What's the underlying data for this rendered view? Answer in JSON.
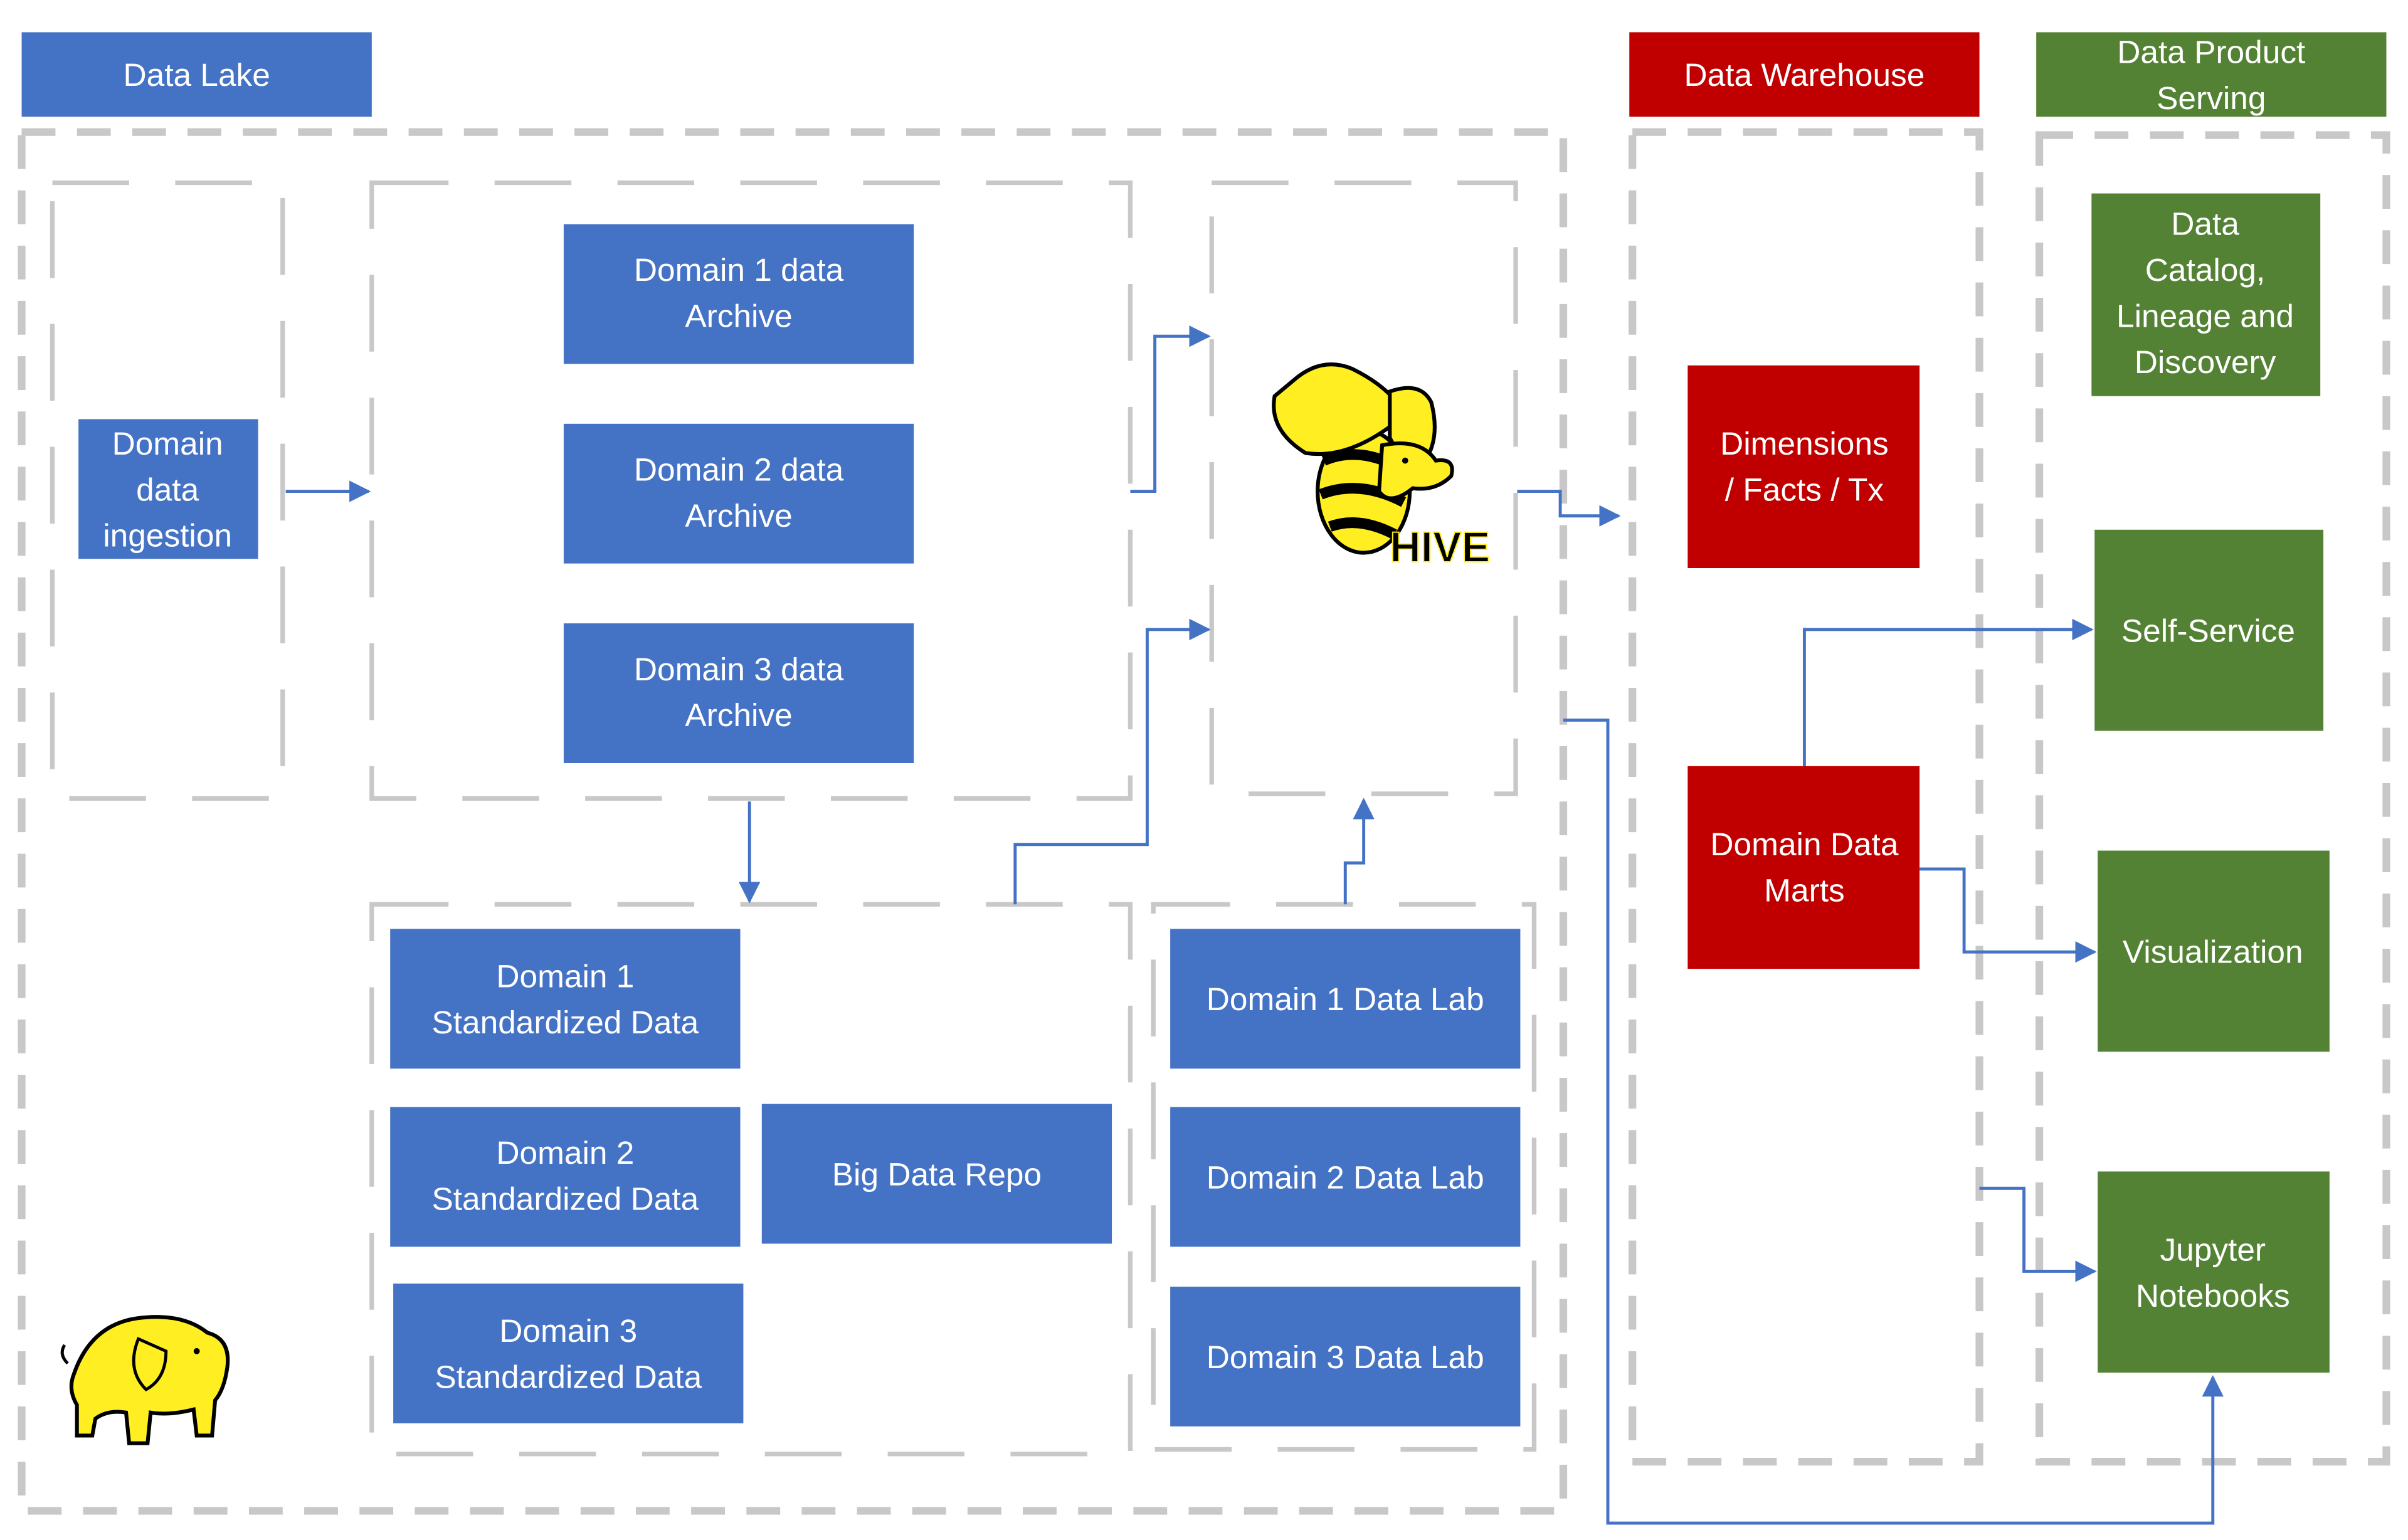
{
  "colors": {
    "blue": "#4472C4",
    "red": "#C00000",
    "green": "#548235",
    "dash": "#C8C8C8"
  },
  "sections": {
    "data_lake": {
      "title": "Data Lake"
    },
    "data_warehouse": {
      "title": "Data Warehouse"
    },
    "data_product_serving": {
      "title_line1": "Data Product",
      "title_line2": "Serving"
    }
  },
  "data_lake": {
    "ingestion": {
      "line1": "Domain",
      "line2": "data",
      "line3": "ingestion"
    },
    "archives": [
      {
        "line1": "Domain 1 data",
        "line2": "Archive"
      },
      {
        "line1": "Domain 2 data",
        "line2": "Archive"
      },
      {
        "line1": "Domain 3 data",
        "line2": "Archive"
      }
    ],
    "standardized": [
      {
        "line1": "Domain 1",
        "line2": "Standardized Data"
      },
      {
        "line1": "Domain 2",
        "line2": "Standardized Data"
      },
      {
        "line1": "Domain 3",
        "line2": "Standardized Data"
      }
    ],
    "big_data_repo": "Big Data Repo",
    "data_labs": [
      "Domain 1 Data Lab",
      "Domain 2 Data Lab",
      "Domain 3 Data Lab"
    ],
    "hive_logo_text": "HIVE",
    "hadoop_logo": "hadoop-elephant-icon"
  },
  "data_warehouse": {
    "dimensions": {
      "line1": "Dimensions",
      "line2": "/ Facts / Tx"
    },
    "marts": {
      "line1": "Domain Data",
      "line2": "Marts"
    }
  },
  "serving": {
    "catalog": {
      "line1": "Data",
      "line2": "Catalog,",
      "line3": "Lineage and",
      "line4": "Discovery"
    },
    "self_service": "Self-Service",
    "visualization": "Visualization",
    "jupyter": {
      "line1": "Jupyter",
      "line2": "Notebooks"
    }
  }
}
